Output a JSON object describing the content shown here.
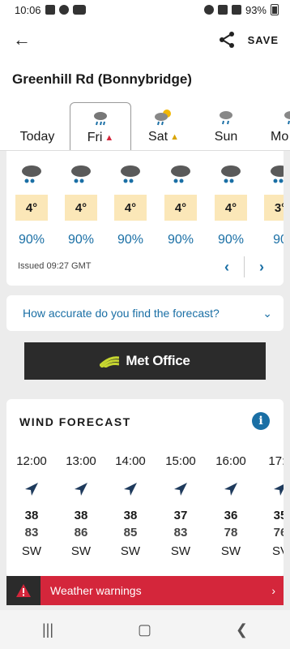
{
  "status": {
    "time": "10:06",
    "battery": "93%"
  },
  "appbar": {
    "back_icon": "arrow-left-icon",
    "share_icon": "share-icon",
    "save_label": "SAVE"
  },
  "location": {
    "name": "Greenhill Rd (Bonnybridge)"
  },
  "days": [
    {
      "label": "Today",
      "icon": "none"
    },
    {
      "label": "Fri",
      "icon": "rain-cloud-icon",
      "warning": "red",
      "active": true
    },
    {
      "label": "Sat",
      "icon": "sun-cloud-rain-icon",
      "warning": "amber"
    },
    {
      "label": "Sun",
      "icon": "rain-cloud-icon"
    },
    {
      "label": "Mo",
      "icon": "rain-cloud-icon"
    }
  ],
  "hourly": {
    "temps": [
      "4°",
      "4°",
      "4°",
      "4°",
      "4°",
      "3°"
    ],
    "precip": [
      "90%",
      "90%",
      "90%",
      "90%",
      "90%",
      "90"
    ],
    "issued": "Issued 09:27 GMT"
  },
  "accuracy": {
    "question": "How accurate do you find the forecast?"
  },
  "brand": {
    "name": "Met Office"
  },
  "wind": {
    "title": "WIND FORECAST",
    "info_icon": "i",
    "columns": [
      {
        "time": "12:00",
        "speed": "38",
        "gust": "83",
        "dir": "SW"
      },
      {
        "time": "13:00",
        "speed": "38",
        "gust": "86",
        "dir": "SW"
      },
      {
        "time": "14:00",
        "speed": "38",
        "gust": "85",
        "dir": "SW"
      },
      {
        "time": "15:00",
        "speed": "37",
        "gust": "83",
        "dir": "SW"
      },
      {
        "time": "16:00",
        "speed": "36",
        "gust": "78",
        "dir": "SW"
      },
      {
        "time": "17:0",
        "speed": "35",
        "gust": "76",
        "dir": "SV"
      }
    ]
  },
  "warnings": {
    "label": "Weather warnings"
  },
  "colors": {
    "accent": "#1a6fa5",
    "warning_red": "#d4263b",
    "temp_bg": "#fbe7b8",
    "dark": "#2b2b2b"
  }
}
